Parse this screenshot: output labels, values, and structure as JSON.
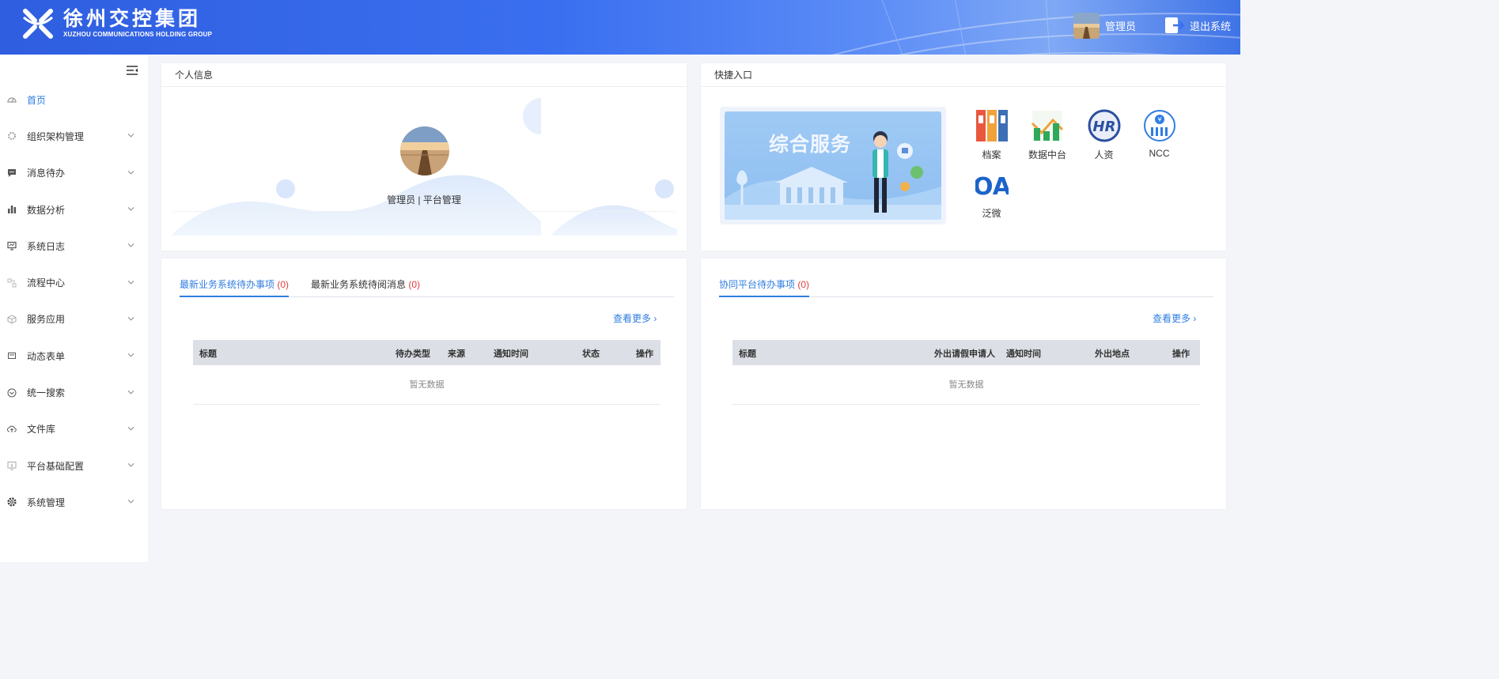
{
  "header": {
    "logo_cn": "徐州交控集团",
    "logo_en": "XUZHOU COMMUNICATIONS HOLDING GROUP",
    "user_name": "管理员",
    "logout_label": "退出系统"
  },
  "sidebar": {
    "items": [
      {
        "label": "首页",
        "icon": "dashboard-icon"
      },
      {
        "label": "组织架构管理",
        "icon": "gear-icon"
      },
      {
        "label": "消息待办",
        "icon": "message-icon"
      },
      {
        "label": "数据分析",
        "icon": "bar-chart-icon"
      },
      {
        "label": "系统日志",
        "icon": "monitor-icon"
      },
      {
        "label": "流程中心",
        "icon": "flow-icon"
      },
      {
        "label": "服务应用",
        "icon": "cube-icon"
      },
      {
        "label": "动态表单",
        "icon": "form-icon"
      },
      {
        "label": "统一搜索",
        "icon": "search-icon"
      },
      {
        "label": "文件库",
        "icon": "cloud-icon"
      },
      {
        "label": "平台基础配置",
        "icon": "config-icon"
      },
      {
        "label": "系统管理",
        "icon": "settings-icon"
      }
    ]
  },
  "profile": {
    "title": "个人信息",
    "name_role": "管理员 | 平台管理"
  },
  "quick": {
    "title": "快捷入口",
    "banner_title": "综合服务",
    "items": [
      {
        "label": "档案",
        "icon": "archive-icon"
      },
      {
        "label": "数据中台",
        "icon": "data-platform-icon"
      },
      {
        "label": "人资",
        "icon": "hr-icon"
      },
      {
        "label": "NCC",
        "icon": "ncc-icon"
      },
      {
        "label": "泛微",
        "icon": "oa-icon"
      }
    ]
  },
  "todo_panel": {
    "tabs": [
      {
        "label": "最新业务系统待办事项 ",
        "count": "(0)"
      },
      {
        "label": "最新业务系统待阅消息 ",
        "count": "(0)"
      }
    ],
    "more": "查看更多",
    "columns": [
      "标题",
      "待办类型",
      "来源",
      "通知时间",
      "状态",
      "操作"
    ],
    "empty": "暂无数据"
  },
  "collab_panel": {
    "tabs": [
      {
        "label": "协同平台待办事项 ",
        "count": "(0)"
      }
    ],
    "more": "查看更多",
    "columns": [
      "标题",
      "外出请假申请人",
      "通知时间",
      "外出地点",
      "操作"
    ],
    "empty": "暂无数据"
  },
  "colors": {
    "accent": "#2f7de1",
    "count_red": "#e03c3c",
    "header_blue": "#3a6ff0"
  }
}
